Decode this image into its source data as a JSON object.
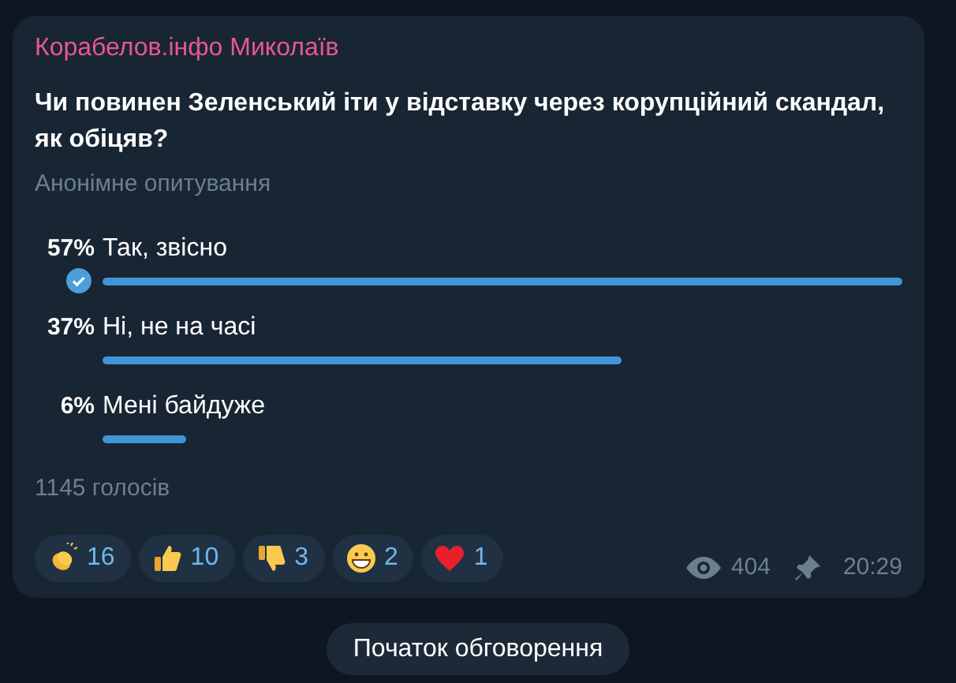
{
  "message": {
    "author": "Корабелов.інфо Миколаїв",
    "question": "Чи повинен Зеленський іти у відставку через корупційний скандал, як обіцяв?",
    "poll_type": "Анонімне опитування",
    "options": [
      {
        "percent": "57%",
        "label": "Так, звісно",
        "selected": true
      },
      {
        "percent": "37%",
        "label": "Ні, не на часі",
        "selected": false
      },
      {
        "percent": "6%",
        "label": "Мені байдуже",
        "selected": false
      }
    ],
    "votes": "1145 голосів",
    "reactions": [
      {
        "kind": "clap",
        "count": "16"
      },
      {
        "kind": "thumbs_up",
        "count": "10"
      },
      {
        "kind": "thumbs_down",
        "count": "3"
      },
      {
        "kind": "grin",
        "count": "2"
      },
      {
        "kind": "heart",
        "count": "1"
      }
    ],
    "views": "404",
    "time": "20:29"
  },
  "discussion_button": "Початок обговорення"
}
